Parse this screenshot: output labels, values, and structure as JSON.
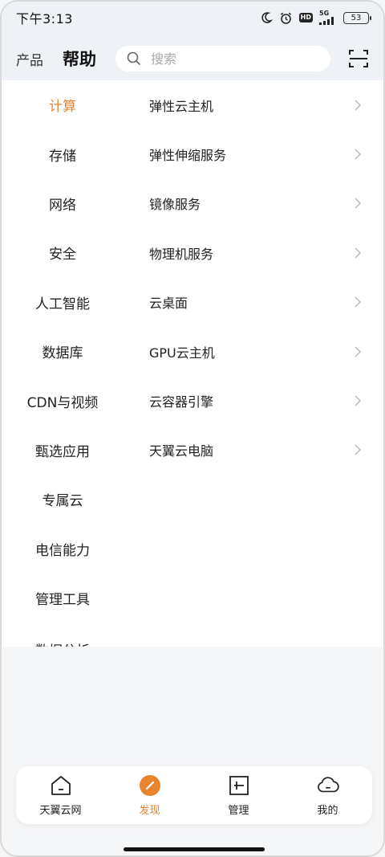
{
  "status_bar": {
    "time": "下午3:13",
    "hd": "HD",
    "network": "5G",
    "battery": "53"
  },
  "header": {
    "tab_products": "产品",
    "tab_help": "帮助",
    "search_placeholder": "搜索",
    "scan_icon": "scan-icon"
  },
  "categories": [
    {
      "label": "计算",
      "active": true
    },
    {
      "label": "存储"
    },
    {
      "label": "网络"
    },
    {
      "label": "安全"
    },
    {
      "label": "人工智能"
    },
    {
      "label": "数据库"
    },
    {
      "label": "CDN与视频"
    },
    {
      "label": "甄选应用"
    },
    {
      "label": "专属云"
    },
    {
      "label": "电信能力"
    },
    {
      "label": "管理工具"
    },
    {
      "label": "数据分析"
    }
  ],
  "subitems": [
    {
      "label": "弹性云主机"
    },
    {
      "label": "弹性伸缩服务"
    },
    {
      "label": "镜像服务"
    },
    {
      "label": "物理机服务"
    },
    {
      "label": "云桌面"
    },
    {
      "label": "GPU云主机"
    },
    {
      "label": "云容器引擎"
    },
    {
      "label": "天翼云电脑"
    }
  ],
  "tabbar": {
    "tabs": [
      {
        "label": "天翼云网",
        "icon": "home-icon"
      },
      {
        "label": "发现",
        "icon": "discover-icon",
        "active": true
      },
      {
        "label": "管理",
        "icon": "manage-icon"
      },
      {
        "label": "我的",
        "icon": "cloud-profile-icon"
      }
    ]
  },
  "colors": {
    "accent": "#e8832e",
    "header_bg": "#eef2f6",
    "text": "#222222"
  }
}
